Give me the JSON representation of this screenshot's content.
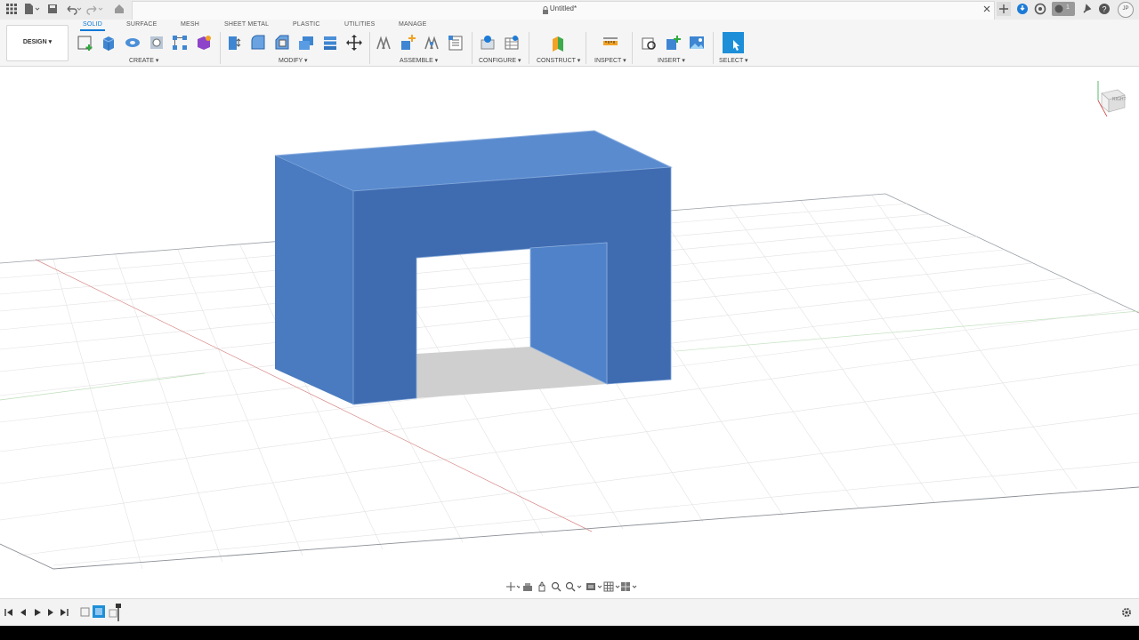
{
  "app": {
    "document_title": "Untitled*",
    "user_initials": "JP",
    "notification_count": "1"
  },
  "workspace": {
    "label": "DESIGN ▾"
  },
  "tabs": [
    "SOLID",
    "SURFACE",
    "MESH",
    "SHEET METAL",
    "PLASTIC",
    "UTILITIES",
    "MANAGE"
  ],
  "active_tab": "SOLID",
  "groups": {
    "create": "CREATE ▾",
    "modify": "MODIFY ▾",
    "assemble": "ASSEMBLE ▾",
    "configure": "CONFIGURE ▾",
    "construct": "CONSTRUCT ▾",
    "inspect": "INSPECT ▾",
    "insert": "INSERT ▾",
    "select": "SELECT ▾"
  },
  "viewcube": {
    "face_label": "RIGHT"
  },
  "colors": {
    "accent": "#0a78d7",
    "body": "#4a7bc0",
    "body_dark": "#3f6bb1",
    "body_light": "#5a8bcf",
    "grid": "#e0e0e0"
  },
  "icons": {
    "title_left": [
      "apps-grid-icon",
      "file-menu-icon",
      "save-icon",
      "undo-icon",
      "redo-icon",
      "home-icon"
    ],
    "title_right": [
      "close-tab-icon",
      "new-tab-icon",
      "job-status-icon",
      "extensions-icon",
      "notifications-icon",
      "help-icon",
      "user-avatar-icon"
    ],
    "timeline": [
      "first-step-icon",
      "previous-step-icon",
      "play-icon",
      "next-step-icon",
      "last-step-icon",
      "sketch-feature-icon",
      "extrude-feature-icon",
      "timeline-marker-icon",
      "timeline-settings-icon"
    ],
    "navbar": [
      "orbit-icon",
      "look-at-icon",
      "pan-icon",
      "zoom-icon",
      "zoom-window-icon",
      "display-settings-icon",
      "grid-settings-icon",
      "viewports-icon"
    ]
  }
}
